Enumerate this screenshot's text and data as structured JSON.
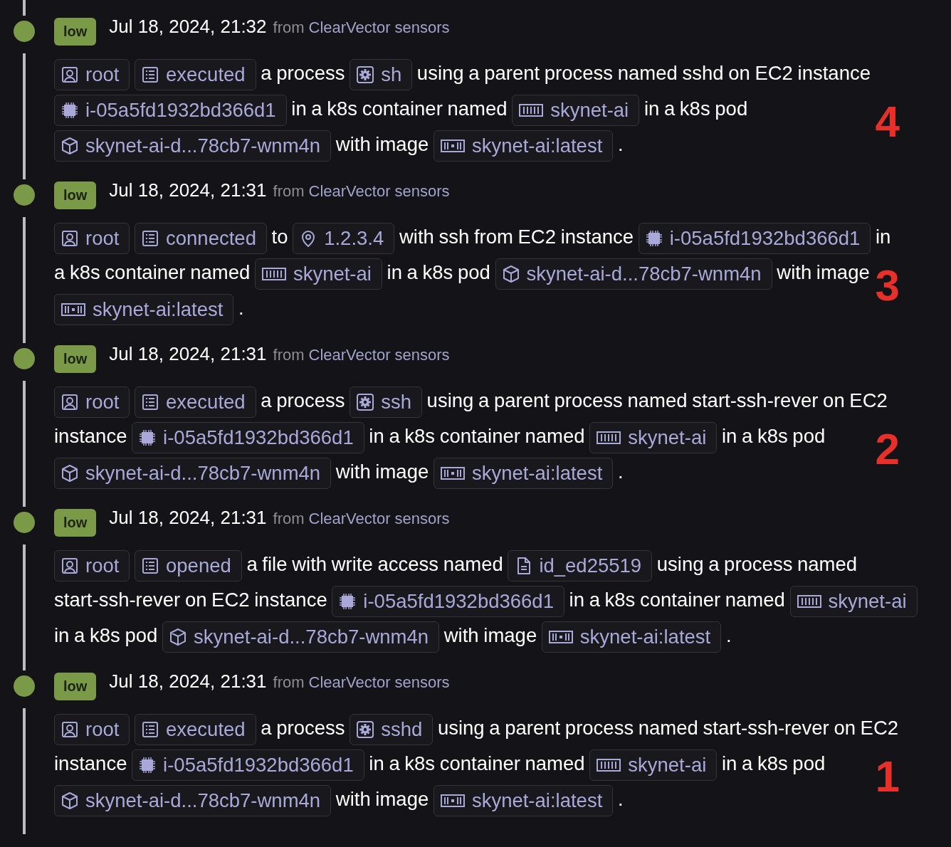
{
  "events": [
    {
      "severity": "low",
      "time": "Jul 18, 2024, 21:32",
      "source_prefix": "from",
      "source": "ClearVector sensors",
      "marker": "4",
      "parts": [
        {
          "kind": "user",
          "text": "root"
        },
        {
          "kind": "action",
          "text": "executed"
        },
        {
          "kind": "text",
          "text": "a process"
        },
        {
          "kind": "process",
          "text": "sh"
        },
        {
          "kind": "text",
          "text": "using a parent process named sshd on EC2 instance"
        },
        {
          "kind": "instance",
          "text": "i-05a5fd1932bd366d1"
        },
        {
          "kind": "text",
          "text": "in a k8s container named"
        },
        {
          "kind": "container",
          "text": "skynet-ai"
        },
        {
          "kind": "text",
          "text": "in a k8s pod"
        },
        {
          "kind": "pod",
          "text": "skynet-ai-d...78cb7-wnm4n"
        },
        {
          "kind": "text",
          "text": "with image"
        },
        {
          "kind": "image",
          "text": "skynet-ai:latest"
        },
        {
          "kind": "text",
          "text": "."
        }
      ]
    },
    {
      "severity": "low",
      "time": "Jul 18, 2024, 21:31",
      "source_prefix": "from",
      "source": "ClearVector sensors",
      "marker": "3",
      "parts": [
        {
          "kind": "user",
          "text": "root"
        },
        {
          "kind": "action",
          "text": "connected"
        },
        {
          "kind": "text",
          "text": "to"
        },
        {
          "kind": "address",
          "text": "1.2.3.4"
        },
        {
          "kind": "text",
          "text": "with ssh from EC2 instance"
        },
        {
          "kind": "instance",
          "text": "i-05a5fd1932bd366d1"
        },
        {
          "kind": "text",
          "text": "in"
        },
        {
          "kind": "text",
          "text": "a k8s container named"
        },
        {
          "kind": "container",
          "text": "skynet-ai"
        },
        {
          "kind": "text",
          "text": "in a k8s pod"
        },
        {
          "kind": "pod",
          "text": "skynet-ai-d...78cb7-wnm4n"
        },
        {
          "kind": "text",
          "text": "with image"
        },
        {
          "kind": "image",
          "text": "skynet-ai:latest"
        },
        {
          "kind": "text",
          "text": "."
        }
      ]
    },
    {
      "severity": "low",
      "time": "Jul 18, 2024, 21:31",
      "source_prefix": "from",
      "source": "ClearVector sensors",
      "marker": "2",
      "parts": [
        {
          "kind": "user",
          "text": "root"
        },
        {
          "kind": "action",
          "text": "executed"
        },
        {
          "kind": "text",
          "text": "a process"
        },
        {
          "kind": "process",
          "text": "ssh"
        },
        {
          "kind": "text",
          "text": "using a parent process named start-ssh-rever on EC2"
        },
        {
          "kind": "text",
          "text": "instance"
        },
        {
          "kind": "instance",
          "text": "i-05a5fd1932bd366d1"
        },
        {
          "kind": "text",
          "text": "in a k8s container named"
        },
        {
          "kind": "container",
          "text": "skynet-ai"
        },
        {
          "kind": "text",
          "text": "in a k8s pod"
        },
        {
          "kind": "pod",
          "text": "skynet-ai-d...78cb7-wnm4n"
        },
        {
          "kind": "text",
          "text": "with image"
        },
        {
          "kind": "image",
          "text": "skynet-ai:latest"
        },
        {
          "kind": "text",
          "text": "."
        }
      ]
    },
    {
      "severity": "low",
      "time": "Jul 18, 2024, 21:31",
      "source_prefix": "from",
      "source": "ClearVector sensors",
      "parts": [
        {
          "kind": "user",
          "text": "root"
        },
        {
          "kind": "action",
          "text": "opened"
        },
        {
          "kind": "text",
          "text": "a file with write access named"
        },
        {
          "kind": "file",
          "text": "id_ed25519"
        },
        {
          "kind": "text",
          "text": "using a process named"
        },
        {
          "kind": "text",
          "text": "start-ssh-rever on EC2 instance"
        },
        {
          "kind": "instance",
          "text": "i-05a5fd1932bd366d1"
        },
        {
          "kind": "text",
          "text": "in a k8s container named"
        },
        {
          "kind": "container",
          "text": "skynet-ai"
        },
        {
          "kind": "text",
          "text": "in a k8s pod"
        },
        {
          "kind": "pod",
          "text": "skynet-ai-d...78cb7-wnm4n"
        },
        {
          "kind": "text",
          "text": "with image"
        },
        {
          "kind": "image",
          "text": "skynet-ai:latest"
        },
        {
          "kind": "text",
          "text": "."
        }
      ]
    },
    {
      "severity": "low",
      "time": "Jul 18, 2024, 21:31",
      "source_prefix": "from",
      "source": "ClearVector sensors",
      "marker": "1",
      "parts": [
        {
          "kind": "user",
          "text": "root"
        },
        {
          "kind": "action",
          "text": "executed"
        },
        {
          "kind": "text",
          "text": "a process"
        },
        {
          "kind": "process",
          "text": "sshd"
        },
        {
          "kind": "text",
          "text": "using a parent process named start-ssh-rever on EC2"
        },
        {
          "kind": "text",
          "text": "instance"
        },
        {
          "kind": "instance",
          "text": "i-05a5fd1932bd366d1"
        },
        {
          "kind": "text",
          "text": "in a k8s container named"
        },
        {
          "kind": "container",
          "text": "skynet-ai"
        },
        {
          "kind": "text",
          "text": "in a k8s pod"
        },
        {
          "kind": "pod",
          "text": "skynet-ai-d...78cb7-wnm4n"
        },
        {
          "kind": "text",
          "text": "with image"
        },
        {
          "kind": "image",
          "text": "skynet-ai:latest"
        },
        {
          "kind": "text",
          "text": "."
        }
      ]
    }
  ]
}
